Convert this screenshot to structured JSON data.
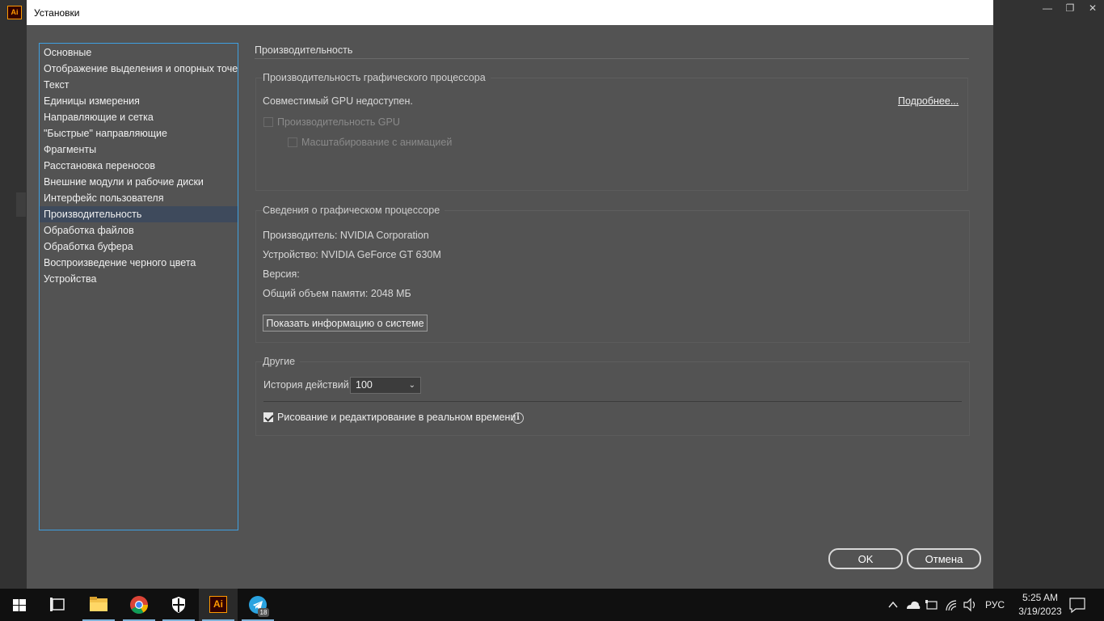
{
  "background_app": {
    "logo_text": "Ai",
    "window_controls": [
      "—",
      "❐",
      "✕"
    ]
  },
  "dialog": {
    "title": "Установки",
    "sidebar": {
      "items": [
        {
          "label": "Основные"
        },
        {
          "label": "Отображение выделения и опорных точек"
        },
        {
          "label": "Текст"
        },
        {
          "label": "Единицы измерения"
        },
        {
          "label": "Направляющие и сетка"
        },
        {
          "label": "\"Быстрые\" направляющие"
        },
        {
          "label": "Фрагменты"
        },
        {
          "label": "Расстановка переносов"
        },
        {
          "label": "Внешние модули и рабочие диски"
        },
        {
          "label": "Интерфейс пользователя"
        },
        {
          "label": "Производительность"
        },
        {
          "label": "Обработка файлов"
        },
        {
          "label": "Обработка буфера"
        },
        {
          "label": "Воспроизведение черного цвета"
        },
        {
          "label": "Устройства"
        }
      ],
      "selected_index": 10
    },
    "section_title": "Производительность",
    "gpu_performance": {
      "label": "Производительность графического процессора",
      "status": "Совместимый GPU недоступен.",
      "more_link": "Подробнее...",
      "gpu_checkbox_label": "Производительность GPU",
      "gpu_checked": false,
      "animated_zoom_label": "Масштабирование с анимацией",
      "animated_zoom_checked": false
    },
    "gpu_info": {
      "label": "Сведения о графическом процессоре",
      "vendor": "Производитель: NVIDIA Corporation",
      "device": "Устройство: NVIDIA GeForce GT 630M",
      "version": "Версия:",
      "memory": "Общий объем памяти: 2048 МБ",
      "system_info_button": "Показать информацию о системе"
    },
    "other": {
      "label": "Другие",
      "history_label": "История действий:",
      "history_value": "100",
      "realtime_label": "Рисование и редактирование в реальном времени",
      "realtime_checked": true,
      "info_icon": "i"
    },
    "ok_button": "OK",
    "cancel_button": "Отмена"
  },
  "taskbar": {
    "language": "РУС",
    "time": "5:25 AM",
    "date": "3/19/2023",
    "telegram_badge": "18",
    "ai_label": "Ai"
  }
}
